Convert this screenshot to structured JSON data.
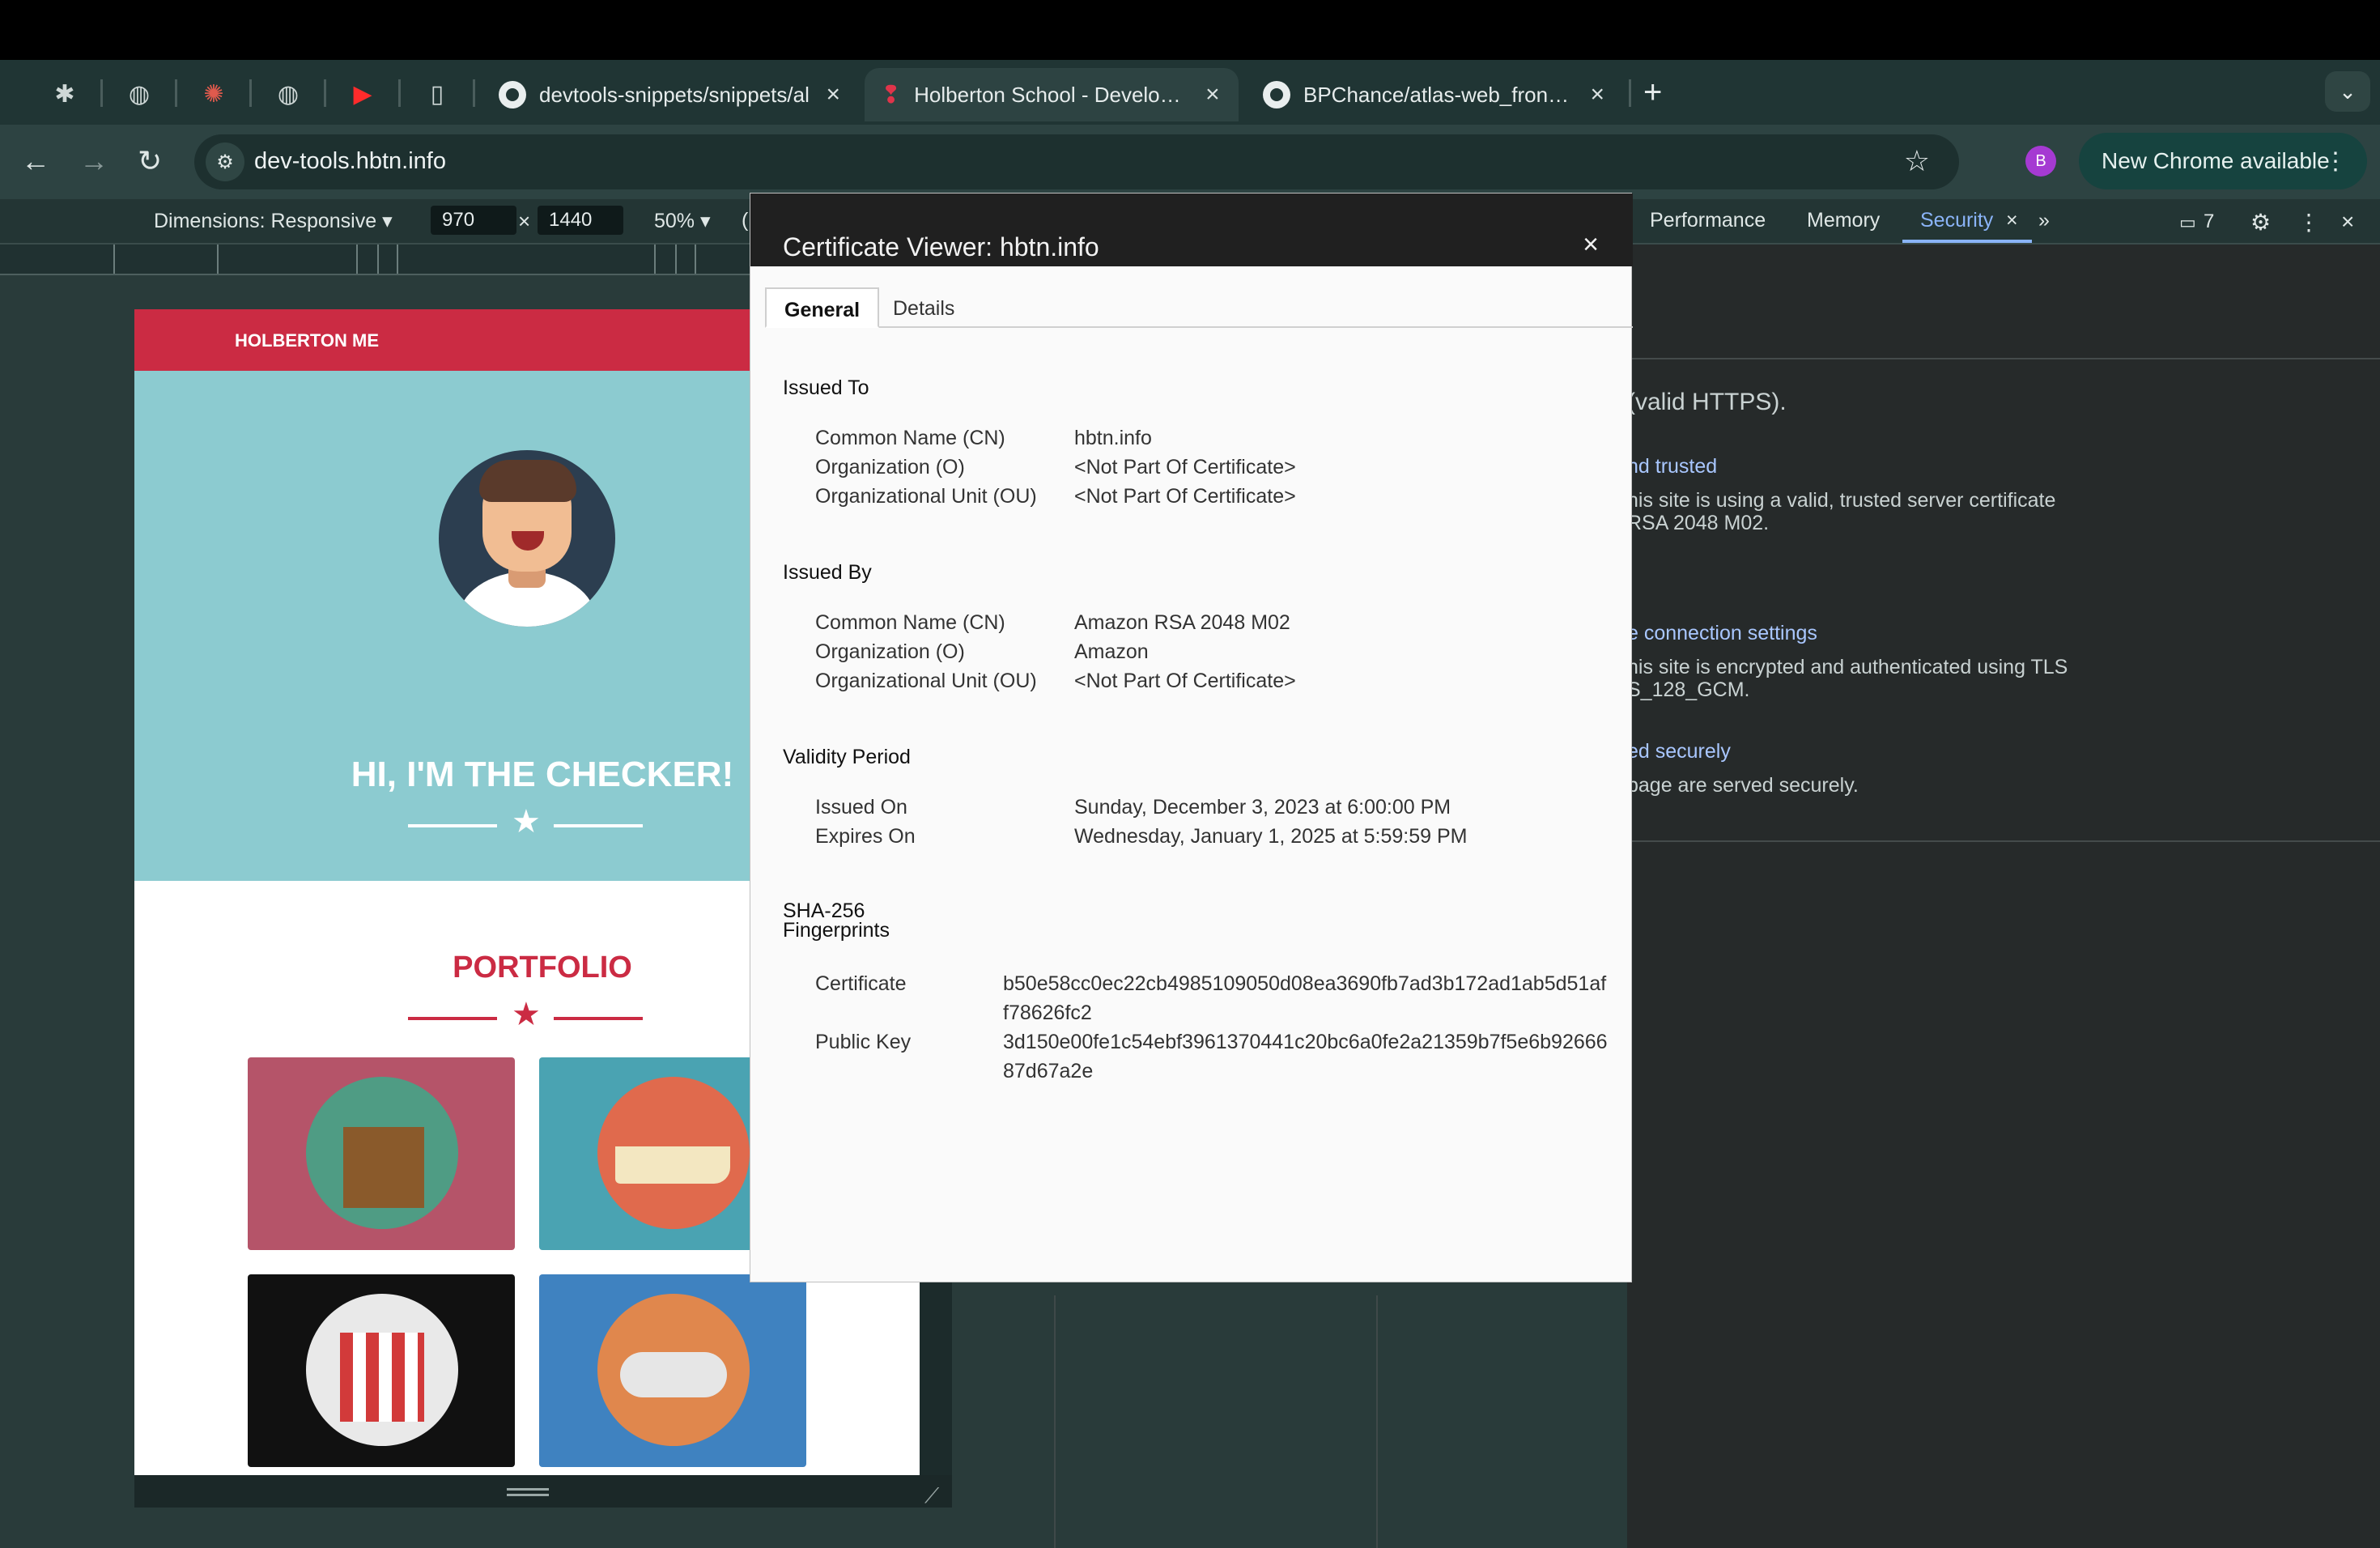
{
  "browser": {
    "tabs": [
      {
        "title": "devtools-snippets/snippets/al",
        "icon": "github-icon"
      },
      {
        "title": "Holberton School - Developer",
        "icon": "holberton-icon",
        "active": true
      },
      {
        "title": "BPChance/atlas-web_front_e",
        "icon": "github-icon"
      }
    ],
    "new_tab": "+",
    "tab_search": "⌄",
    "url": "dev-tools.hbtn.info",
    "profile_initial": "B",
    "new_chrome_label": "New Chrome available",
    "colors": {
      "active_tab": "#2d4342",
      "toolbar": "#2d4342",
      "accent_link": "#8ab4f8"
    }
  },
  "device_toolbar": {
    "dimensions_label": "Dimensions: Responsive ▾",
    "width": "970",
    "height": "1440",
    "times": "×",
    "zoom": "50% ▾",
    "extra": "("
  },
  "devtools": {
    "tabs": [
      "Performance",
      "Memory",
      "Security"
    ],
    "active_tab": "Security",
    "close_tab": "×",
    "more": "»",
    "issues_count": "7",
    "security": {
      "summary": "(valid HTTPS).",
      "cert_heading": "nd trusted",
      "cert_text_1": "his site is using a valid, trusted server certificate",
      "cert_text_2": "RSA 2048 M02.",
      "conn_heading": "e connection settings",
      "conn_text_1": "his site is encrypted and authenticated using TLS",
      "conn_text_2": "S_128_GCM.",
      "res_heading": "ed securely",
      "res_text": "page are served securely."
    }
  },
  "site": {
    "brand": "HOLBERTON ME",
    "hero_title": "HI, I'M THE CHECKER!",
    "portfolio_title": "PORTFOLIO",
    "colors": {
      "nav": "#cb2b43",
      "hero": "#8ccbd0"
    }
  },
  "certificate": {
    "title": "Certificate Viewer: hbtn.info",
    "close": "×",
    "tabs": [
      "General",
      "Details"
    ],
    "issued_to": {
      "heading": "Issued To",
      "rows": [
        {
          "label": "Common Name (CN)",
          "value": "hbtn.info"
        },
        {
          "label": "Organization (O)",
          "value": "<Not Part Of Certificate>"
        },
        {
          "label": "Organizational Unit (OU)",
          "value": "<Not Part Of Certificate>"
        }
      ]
    },
    "issued_by": {
      "heading": "Issued By",
      "rows": [
        {
          "label": "Common Name (CN)",
          "value": "Amazon RSA 2048 M02"
        },
        {
          "label": "Organization (O)",
          "value": "Amazon"
        },
        {
          "label": "Organizational Unit (OU)",
          "value": "<Not Part Of Certificate>"
        }
      ]
    },
    "validity": {
      "heading": "Validity Period",
      "rows": [
        {
          "label": "Issued On",
          "value": "Sunday, December 3, 2023 at 6:00:00 PM"
        },
        {
          "label": "Expires On",
          "value": "Wednesday, January 1, 2025 at 5:59:59 PM"
        }
      ]
    },
    "fingerprints": {
      "heading_1": "SHA-256",
      "heading_2": "Fingerprints",
      "rows": [
        {
          "label": "Certificate",
          "value": "b50e58cc0ec22cb4985109050d08ea3690fb7ad3b172ad1ab5d51aff78626fc2"
        },
        {
          "label": "Public Key",
          "value": "3d150e00fe1c54ebf3961370441c20bc6a0fe2a21359b7f5e6b9266687d67a2e"
        }
      ]
    }
  }
}
